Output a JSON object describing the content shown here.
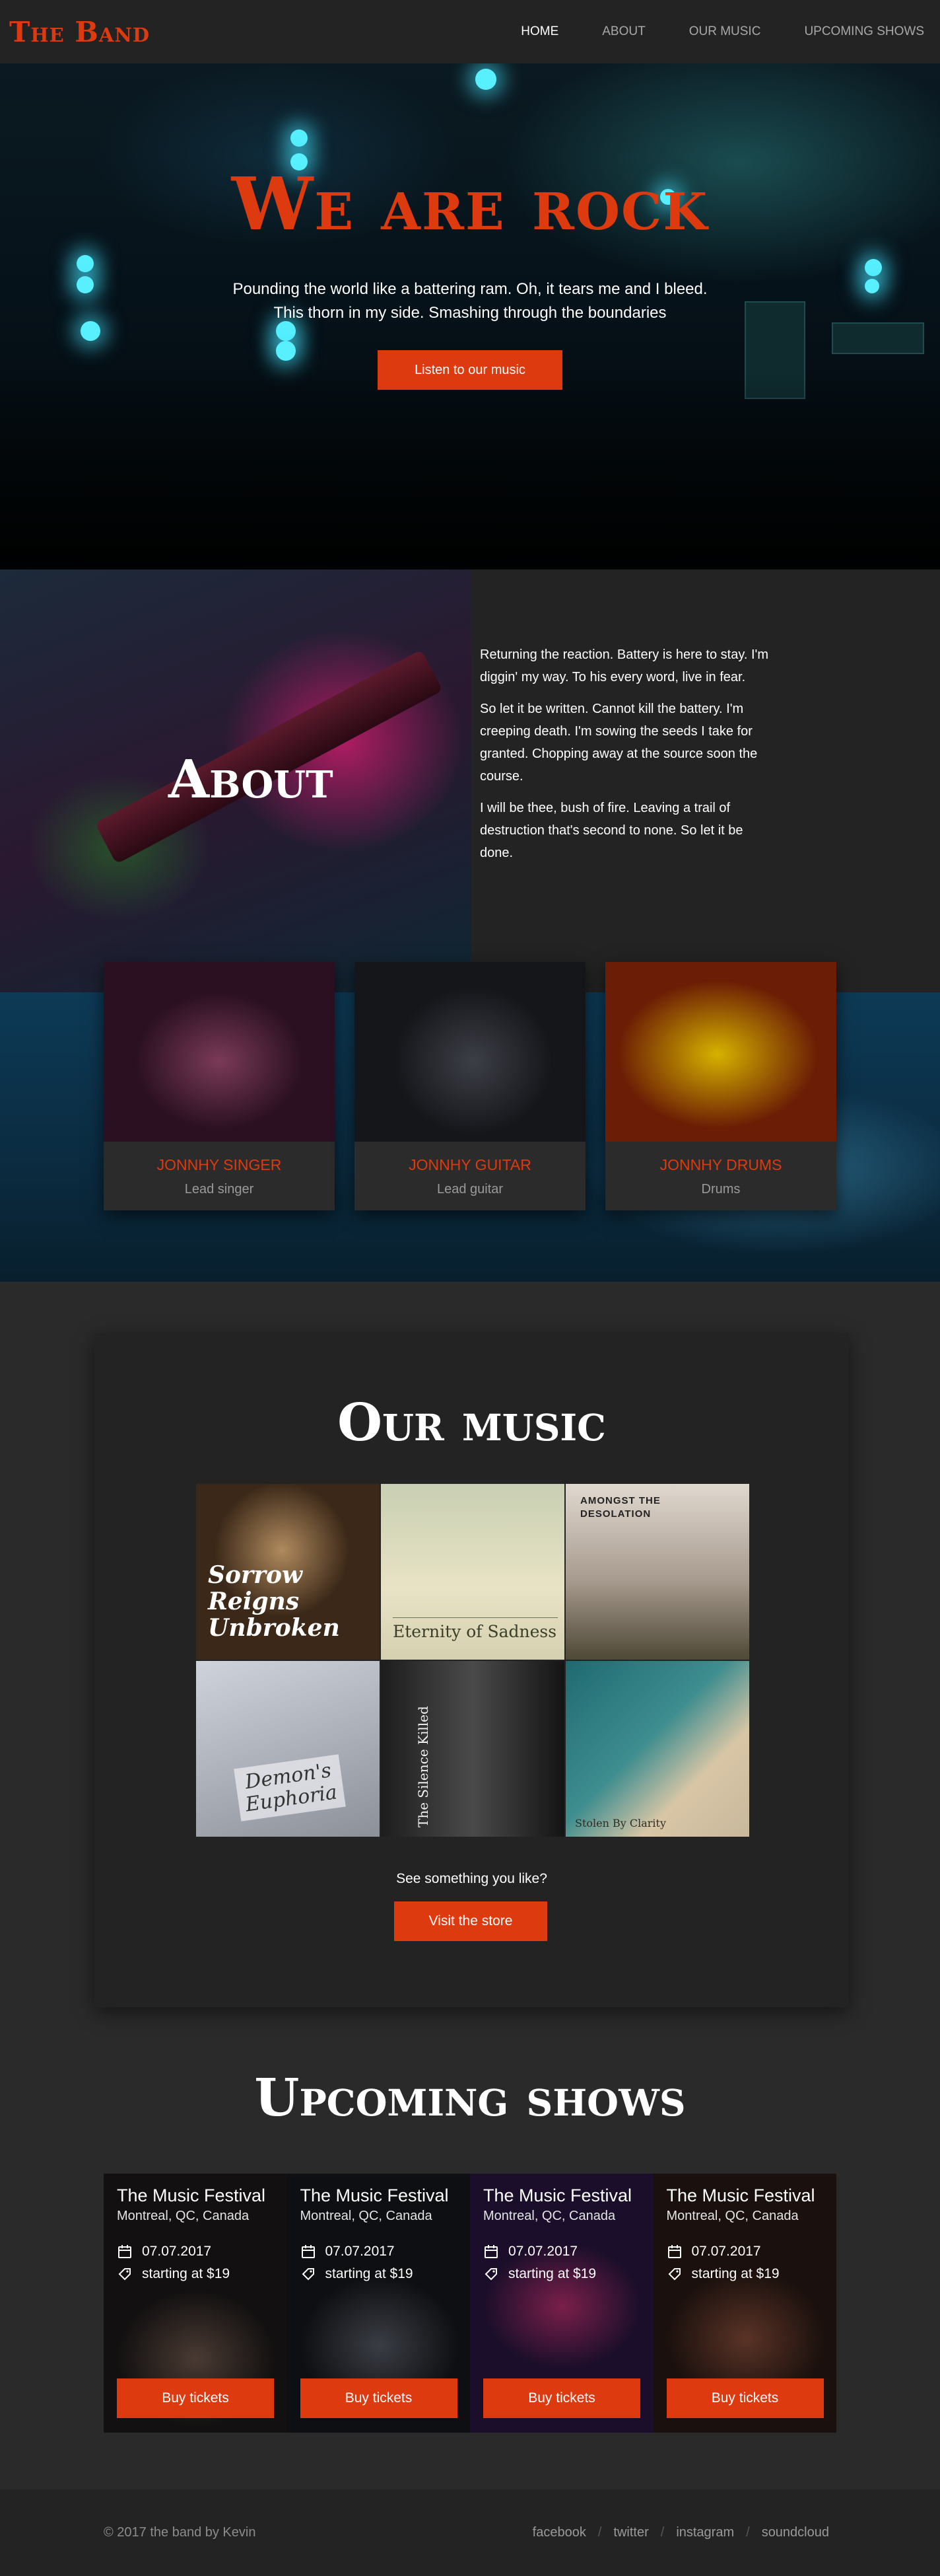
{
  "nav": {
    "logo": "The Band",
    "links": [
      {
        "label": "HOME",
        "active": true
      },
      {
        "label": "ABOUT",
        "active": false
      },
      {
        "label": "OUR MUSIC",
        "active": false
      },
      {
        "label": "UPCOMING SHOWS",
        "active": false
      }
    ]
  },
  "hero": {
    "title": "We are rock",
    "text": "Pounding the world like a battering ram. Oh, it tears me and I bleed. This thorn in my side. Smashing through the boundaries",
    "button": "Listen to our music"
  },
  "about": {
    "title": "About",
    "paragraphs": [
      "Returning the reaction. Battery is here to stay. I'm diggin' my way. To his every word, live in fear.",
      "So let it be written. Cannot kill the battery. I'm creeping death. I'm sowing the seeds I take for granted. Chopping away at the source soon the course.",
      "I will be thee, bush of fire. Leaving a trail of destruction that's second to none. So let it be done."
    ],
    "members": [
      {
        "name": "JONNHY SINGER",
        "role": "Lead singer"
      },
      {
        "name": "JONNHY GUITAR",
        "role": "Lead guitar"
      },
      {
        "name": "JONNHY DRUMS",
        "role": "Drums"
      }
    ]
  },
  "music": {
    "title": "Our music",
    "albums": [
      {
        "title": "Sorrow Reigns Unbroken"
      },
      {
        "title": "Eternity of Sadness"
      },
      {
        "title": "AMONGST THE DESOLATION"
      },
      {
        "title": "Demon's Euphoria"
      },
      {
        "title": "The Silence Killed"
      },
      {
        "title": "Stolen By Clarity"
      }
    ],
    "question": "See something you like?",
    "button": "Visit the store"
  },
  "shows": {
    "title": "Upcoming shows",
    "items": [
      {
        "title": "The Music Festival",
        "location": "Montreal, QC, Canada",
        "date": "07.07.2017",
        "price": "starting at $19",
        "button": "Buy tickets"
      },
      {
        "title": "The Music Festival",
        "location": "Montreal, QC, Canada",
        "date": "07.07.2017",
        "price": "starting at $19",
        "button": "Buy tickets"
      },
      {
        "title": "The Music Festival",
        "location": "Montreal, QC, Canada",
        "date": "07.07.2017",
        "price": "starting at $19",
        "button": "Buy tickets"
      },
      {
        "title": "The Music Festival",
        "location": "Montreal, QC, Canada",
        "date": "07.07.2017",
        "price": "starting at $19",
        "button": "Buy tickets"
      }
    ]
  },
  "footer": {
    "copyright": "© 2017 the band by Kevin",
    "social": [
      "facebook",
      "twitter",
      "instagram",
      "soundcloud"
    ]
  },
  "colors": {
    "accent": "#dd3a10",
    "background": "#2a2a2b",
    "panel": "#232324"
  },
  "icons": {
    "date": "calendar-icon",
    "price": "ticket-icon"
  }
}
